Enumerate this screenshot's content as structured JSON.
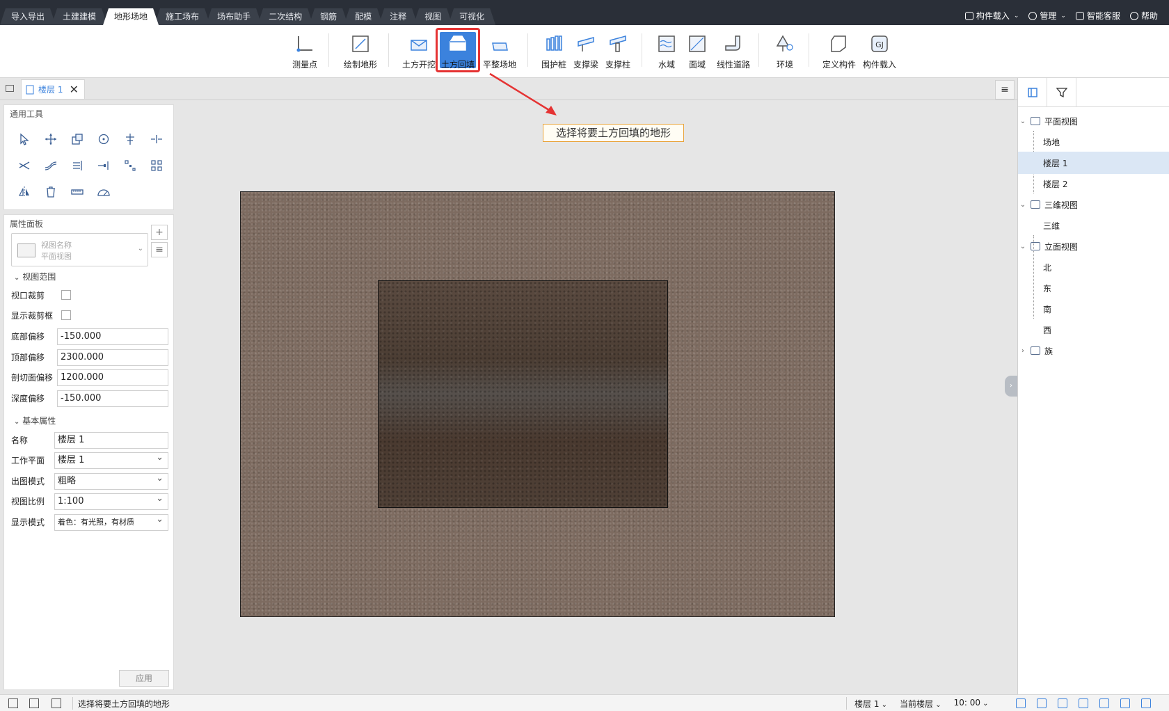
{
  "tabs": [
    "导入导出",
    "土建建模",
    "地形场地",
    "施工场布",
    "场布助手",
    "二次结构",
    "钢筋",
    "配模",
    "注释",
    "视图",
    "可视化"
  ],
  "active_tab": "地形场地",
  "topright": {
    "component_load": "构件载入",
    "manage": "管理",
    "support": "智能客服",
    "help": "帮助"
  },
  "ribbon": {
    "measure_point": "测量点",
    "draw_terrain": "绘制地形",
    "excavate": "土方开挖",
    "backfill": "土方回填",
    "level_site": "平整场地",
    "retaining_pile": "围护桩",
    "support_beam": "支撑梁",
    "support_column": "支撑柱",
    "water_area": "水域",
    "surface_area": "面域",
    "linear_road": "线性道路",
    "environment": "环境",
    "define_component": "定义构件",
    "load_component": "构件载入"
  },
  "doc_tab": {
    "label": "楼层 1"
  },
  "callout": {
    "text": "选择将要土方回填的地形"
  },
  "tools_panel": {
    "title": "通用工具"
  },
  "props": {
    "title": "属性面板",
    "view_name_label": "视图名称",
    "view_name_value": "平面视图",
    "view_range": {
      "title": "视图范围",
      "viewport_crop": "视口裁剪",
      "show_crop_box": "显示裁剪框",
      "bottom_offset_label": "底部偏移",
      "bottom_offset": "-150.000",
      "top_offset_label": "顶部偏移",
      "top_offset": "2300.000",
      "section_offset_label": "剖切面偏移",
      "section_offset": "1200.000",
      "depth_offset_label": "深度偏移",
      "depth_offset": "-150.000"
    },
    "basic": {
      "title": "基本属性",
      "name_label": "名称",
      "name": "楼层 1",
      "workplane_label": "工作平面",
      "workplane": "楼层 1",
      "output_mode_label": "出图模式",
      "output_mode": "粗略",
      "scale_label": "视图比例",
      "scale": "1:100",
      "display_mode_label": "显示模式",
      "display_mode": "着色：有光照，有材质"
    },
    "apply": "应用"
  },
  "tree": {
    "plan_views": "平面视图",
    "site": "场地",
    "floor1": "楼层 1",
    "floor2": "楼层 2",
    "views_3d": "三维视图",
    "view_3d": "三维",
    "elevations": "立面视图",
    "north": "北",
    "east": "东",
    "south": "南",
    "west": "西",
    "families": "族"
  },
  "status": {
    "message": "选择将要土方回填的地形",
    "floor": "楼层 1",
    "current_floor": "当前楼层",
    "time": "10: 00"
  },
  "colors": {
    "accent": "#3b82dd",
    "highlight": "#e53333",
    "topbar": "#2a2f38"
  }
}
